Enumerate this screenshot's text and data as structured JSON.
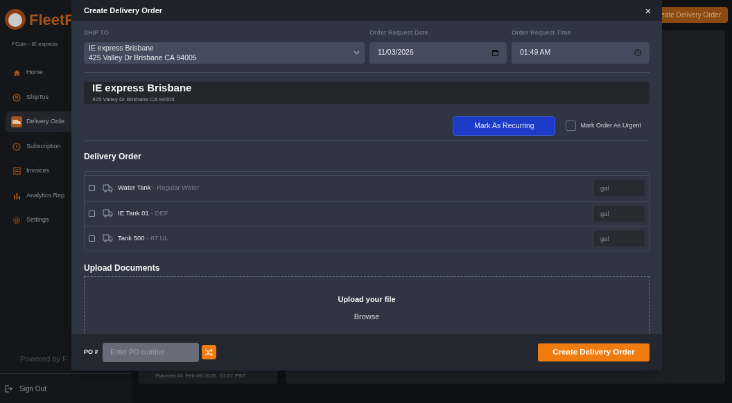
{
  "sidebar": {
    "brand": "FleetP",
    "account": "FCoin - IE express",
    "nav": [
      {
        "label": "Home",
        "selected": false
      },
      {
        "label": "ShipTos",
        "selected": false
      },
      {
        "label": "Delivery Orde",
        "selected": true
      },
      {
        "label": "Subscription",
        "selected": false
      },
      {
        "label": "Invoices",
        "selected": false
      },
      {
        "label": "Analytics Rep",
        "selected": false
      },
      {
        "label": "Settings",
        "selected": false
      }
    ],
    "powered_by": "Powered by F",
    "sign_out": "Sign Out"
  },
  "header_button": "eate Delivery Order",
  "background_card": "Planned At: Feb 09 2026, 01:07 PST",
  "modal": {
    "title": "Create Delivery Order",
    "close": "×",
    "ship_to": {
      "label": "SHIP TO",
      "line_1": "IE express Brisbane",
      "line_2": "425 Valley Dr Brisbane CA 94005"
    },
    "date": {
      "label": "Order Request Date",
      "value": "11/03/2026"
    },
    "time": {
      "label": "Order Request Time",
      "value": "01:49 AM"
    },
    "info_card": {
      "name": "IE express Brisbane",
      "address": "425 Valley Dr Brisbane CA 94005"
    },
    "recurring_button": "Mark As Recurring",
    "urgent": {
      "label": "Mark Order As Urgent",
      "checked": false
    },
    "delivery_order": {
      "title": "Delivery Order",
      "items": [
        {
          "name": "Water Tank",
          "detail": "- Regular Water",
          "checked": false,
          "placeholder": "gal"
        },
        {
          "name": "IE Tank 01",
          "detail": "- DEF",
          "checked": false,
          "placeholder": "gal"
        },
        {
          "name": "Tank 500",
          "detail": "- 87 UL",
          "checked": false,
          "placeholder": "gal"
        }
      ]
    },
    "upload": {
      "title": "Upload Documents",
      "prompt": "Upload your file",
      "browse": "Browse"
    },
    "footer": {
      "po_label": "PO #",
      "po_placeholder": "Enter PO number",
      "submit": "Create Delivery Order"
    }
  }
}
